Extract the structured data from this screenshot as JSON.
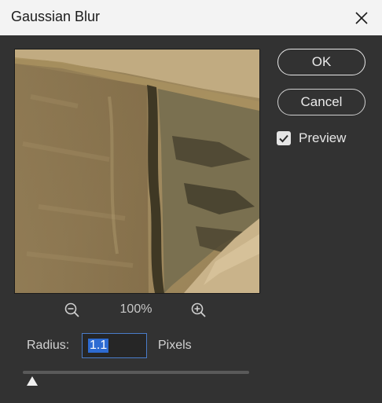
{
  "window": {
    "title": "Gaussian Blur"
  },
  "buttons": {
    "ok": "OK",
    "cancel": "Cancel"
  },
  "preview": {
    "label": "Preview",
    "checked": true
  },
  "zoom": {
    "level": "100%"
  },
  "radius": {
    "label": "Radius:",
    "value": "1.1",
    "unit": "Pixels"
  },
  "slider": {
    "value_fraction": 0.04
  },
  "icons": {
    "close": "close-icon",
    "zoom_out": "zoom-out-icon",
    "zoom_in": "zoom-in-icon",
    "check": "checkmark-icon"
  },
  "colors": {
    "title_bar": "#f3f3f3",
    "dialog_bg": "#323232",
    "selection": "#2d6bd2",
    "input_border": "#4a7cc9"
  }
}
